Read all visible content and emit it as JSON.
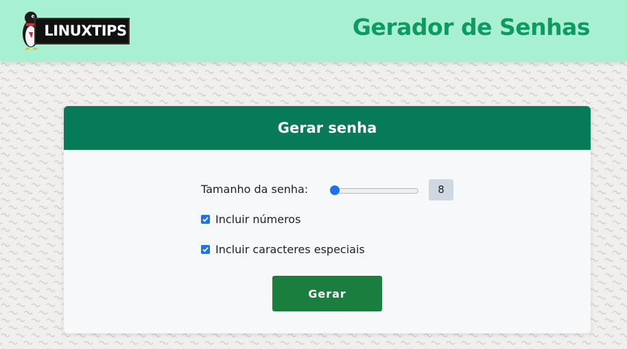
{
  "header": {
    "logo_text": "LINUXTIPS",
    "title": "Gerador de Senhas"
  },
  "card": {
    "title": "Gerar senha",
    "length_label": "Tamanho da senha:",
    "length_value": "8",
    "slider": {
      "value": 8,
      "position_fraction": 0.0
    },
    "include_numbers": {
      "label": "Incluir números",
      "checked": true
    },
    "include_special": {
      "label": "Incluir caracteres especiais",
      "checked": true
    },
    "generate_label": "Gerar"
  },
  "colors": {
    "header_bg": "#a8f0d2",
    "title_green": "#0f9a63",
    "card_header_bg": "#077a58",
    "button_bg": "#1a7e3f",
    "accent_blue": "#1a73e8"
  },
  "icons": [
    "penguin-logo-icon",
    "checkbox-checked-icon"
  ]
}
